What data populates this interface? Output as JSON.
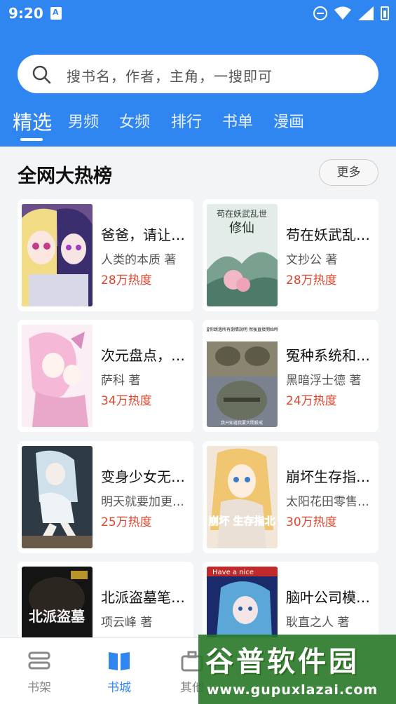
{
  "status_bar": {
    "time": "9:20"
  },
  "search": {
    "placeholder": "搜书名，作者，主角，一搜即可"
  },
  "tabs": [
    {
      "label": "精选",
      "active": true
    },
    {
      "label": "男频"
    },
    {
      "label": "女频"
    },
    {
      "label": "排行"
    },
    {
      "label": "书单"
    },
    {
      "label": "漫画"
    }
  ],
  "section": {
    "title": "全网大热榜",
    "more_label": "更多"
  },
  "books": [
    {
      "title": "爸爸，请让…",
      "author": "人类的本质 著",
      "heat": "28万热度"
    },
    {
      "title": "苟在妖武乱…",
      "author": "文抄公 著",
      "heat": "28万热度"
    },
    {
      "title": "次元盘点，…",
      "author": "萨科 著",
      "heat": "34万热度"
    },
    {
      "title": "冤种系统和…",
      "author": "黑暗浮士德 著",
      "heat": "24万热度"
    },
    {
      "title": "变身少女无…",
      "author": "明天就要加更…",
      "heat": "25万热度"
    },
    {
      "title": "崩坏生存指…",
      "author": "太阳花田零售…",
      "heat": "30万热度"
    },
    {
      "title": "北派盗墓笔…",
      "author": "项云峰 著",
      "heat": ""
    },
    {
      "title": "脑叶公司模…",
      "author": "耿直之人 著",
      "heat": ""
    }
  ],
  "covers": {
    "b2_title": "苟在妖武乱世",
    "b2_subtitle": "修仙",
    "b4_caption_top": "當你跳過所有劇情說明 然後直接開始時",
    "b4_caption_bottom": "我只知道我要大開殺戒",
    "b6_title": "崩坏 生存指北",
    "b7_title": "北派盗墓",
    "b8_text": "Have a nice"
  },
  "bottom_nav": [
    {
      "label": "书架",
      "icon": "bookshelf-icon"
    },
    {
      "label": "书城",
      "icon": "open-book-icon",
      "active": true
    },
    {
      "label": "其他",
      "icon": "briefcase-icon"
    }
  ],
  "watermark": {
    "text": "谷普软件园",
    "url": "www.gupuxlazai.com"
  },
  "colors": {
    "primary": "#2f86f0",
    "heat": "#e0452e"
  }
}
